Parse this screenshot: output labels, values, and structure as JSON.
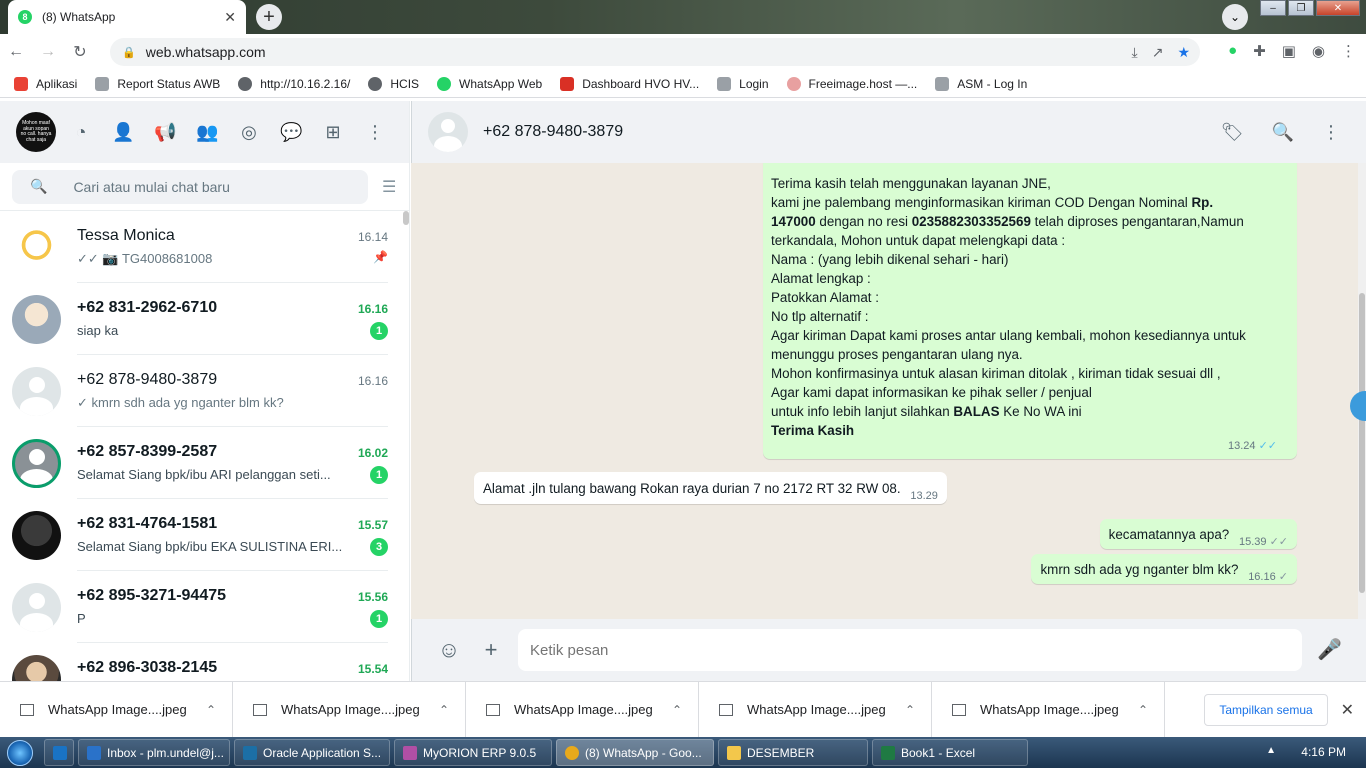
{
  "browser": {
    "tab_title": "(8) WhatsApp",
    "tab_favicon_text": "8",
    "url": "web.whatsapp.com",
    "bookmarks": [
      {
        "label": "Aplikasi",
        "color": "#e94235"
      },
      {
        "label": "Report Status AWB",
        "color": "#9aa0a6"
      },
      {
        "label": "http://10.16.2.16/",
        "color": "#5f6368"
      },
      {
        "label": "HCIS",
        "color": "#5f6368"
      },
      {
        "label": "WhatsApp Web",
        "color": "#25d366"
      },
      {
        "label": "Dashboard HVO HV...",
        "color": "#d93025"
      },
      {
        "label": "Login",
        "color": "#9aa0a6"
      },
      {
        "label": "Freeimage.host —...",
        "color": "#e8a0a0"
      },
      {
        "label": "ASM - Log In",
        "color": "#9aa0a6"
      }
    ]
  },
  "sidebar": {
    "my_avatar_text": "Mohon maaf akun sopan no call. hanya chat saja",
    "search_placeholder": "Cari atau mulai chat baru",
    "chats": [
      {
        "name": "Tessa Monica",
        "time": "16.14",
        "preview": "✓✓ 📷 TG4008681008",
        "unread": "",
        "pinned": true,
        "bold": false,
        "avatar": "duck"
      },
      {
        "name": "+62 831-2962-6710",
        "time": "16.16",
        "preview": "siap ka",
        "unread": "1",
        "pinned": false,
        "bold": true,
        "avatar": "img1"
      },
      {
        "name": "+62 878-9480-3879",
        "time": "16.16",
        "preview": "✓ kmrn sdh ada yg nganter blm kk?",
        "unread": "",
        "pinned": false,
        "bold": false,
        "avatar": "default"
      },
      {
        "name": "+62 857-8399-2587",
        "time": "16.02",
        "preview": "Selamat Siang   bpk/ibu ARI pelanggan seti...",
        "unread": "1",
        "pinned": false,
        "bold": true,
        "avatar": "ring"
      },
      {
        "name": "+62 831-4764-1581",
        "time": "15.57",
        "preview": "Selamat Siang   bpk/ibu EKA SULISTINA ERI...",
        "unread": "3",
        "pinned": false,
        "bold": true,
        "avatar": "img3"
      },
      {
        "name": "+62 895-3271-94475",
        "time": "15.56",
        "preview": "P",
        "unread": "1",
        "pinned": false,
        "bold": true,
        "avatar": "default"
      },
      {
        "name": "+62 896-3038-2145",
        "time": "15.54",
        "preview": "",
        "unread": "",
        "pinned": false,
        "bold": true,
        "avatar": "img2"
      }
    ]
  },
  "conversation": {
    "contact": "+62 878-9480-3879",
    "big_message": {
      "lines": [
        {
          "parts": [
            {
              "t": "Terima kasih telah menggunakan layanan JNE,"
            }
          ]
        },
        {
          "parts": [
            {
              "t": "kami jne palembang menginformasikan kiriman  COD Dengan Nominal "
            },
            {
              "t": "Rp.",
              "b": true
            }
          ]
        },
        {
          "parts": [
            {
              "t": "147000",
              "b": true
            },
            {
              "t": " dengan no resi "
            },
            {
              "t": "0235882303352569",
              "b": true
            },
            {
              "t": " telah diproses pengantaran,Namun"
            }
          ]
        },
        {
          "parts": [
            {
              "t": "terkandala, Mohon untuk dapat melengkapi data :"
            }
          ]
        },
        {
          "parts": [
            {
              "t": "Nama : (yang lebih dikenal sehari - hari)"
            }
          ]
        },
        {
          "parts": [
            {
              "t": "Alamat  lengkap :"
            }
          ]
        },
        {
          "parts": [
            {
              "t": "Patokkan Alamat :"
            }
          ]
        },
        {
          "parts": [
            {
              "t": "No tlp alternatif :"
            }
          ]
        },
        {
          "parts": [
            {
              "t": "Agar kiriman Dapat kami proses antar ulang kembali, mohon kesediannya untuk"
            }
          ]
        },
        {
          "parts": [
            {
              "t": "menunggu proses pengantaran ulang nya."
            }
          ]
        },
        {
          "parts": [
            {
              "t": "Mohon konfirmasinya untuk alasan kiriman ditolak , kiriman tidak sesuai dll ,"
            }
          ]
        },
        {
          "parts": [
            {
              "t": "Agar kami dapat informasikan ke pihak seller / penjual"
            }
          ]
        },
        {
          "parts": [
            {
              "t": "untuk info lebih lanjut silahkan "
            },
            {
              "t": "BALAS",
              "b": true
            },
            {
              "t": " Ke No WA ini"
            }
          ]
        },
        {
          "parts": [
            {
              "t": "Terima Kasih",
              "b": true
            }
          ]
        }
      ],
      "time": "13.24"
    },
    "msg_in": {
      "text": "Alamat .jln tulang bawang Rokan raya durian 7 no 2172 RT 32  RW 08.",
      "time": "13.29"
    },
    "msg_out1": {
      "text": "kecamatannya apa?",
      "time": "15.39"
    },
    "msg_out2": {
      "text": "kmrn sdh ada yg nganter blm kk?",
      "time": "16.16"
    },
    "input_placeholder": "Ketik pesan"
  },
  "downloads": {
    "items": [
      "WhatsApp Image....jpeg",
      "WhatsApp Image....jpeg",
      "WhatsApp Image....jpeg",
      "WhatsApp Image....jpeg",
      "WhatsApp Image....jpeg"
    ],
    "show_all": "Tampilkan semua"
  },
  "taskbar": {
    "items": [
      {
        "label": "Inbox - plm.undel@j...",
        "color": "#2a72c9"
      },
      {
        "label": "Oracle Application S...",
        "color": "#1c6fa6"
      },
      {
        "label": "MyORION ERP 9.0.5",
        "color": "#b04fa5"
      },
      {
        "label": "(8) WhatsApp - Goo...",
        "color": "#e8a91b"
      },
      {
        "label": "DESEMBER",
        "color": "#f3c74b"
      },
      {
        "label": "Book1 - Excel",
        "color": "#1f7a43"
      }
    ],
    "clock": "4:16 PM"
  }
}
